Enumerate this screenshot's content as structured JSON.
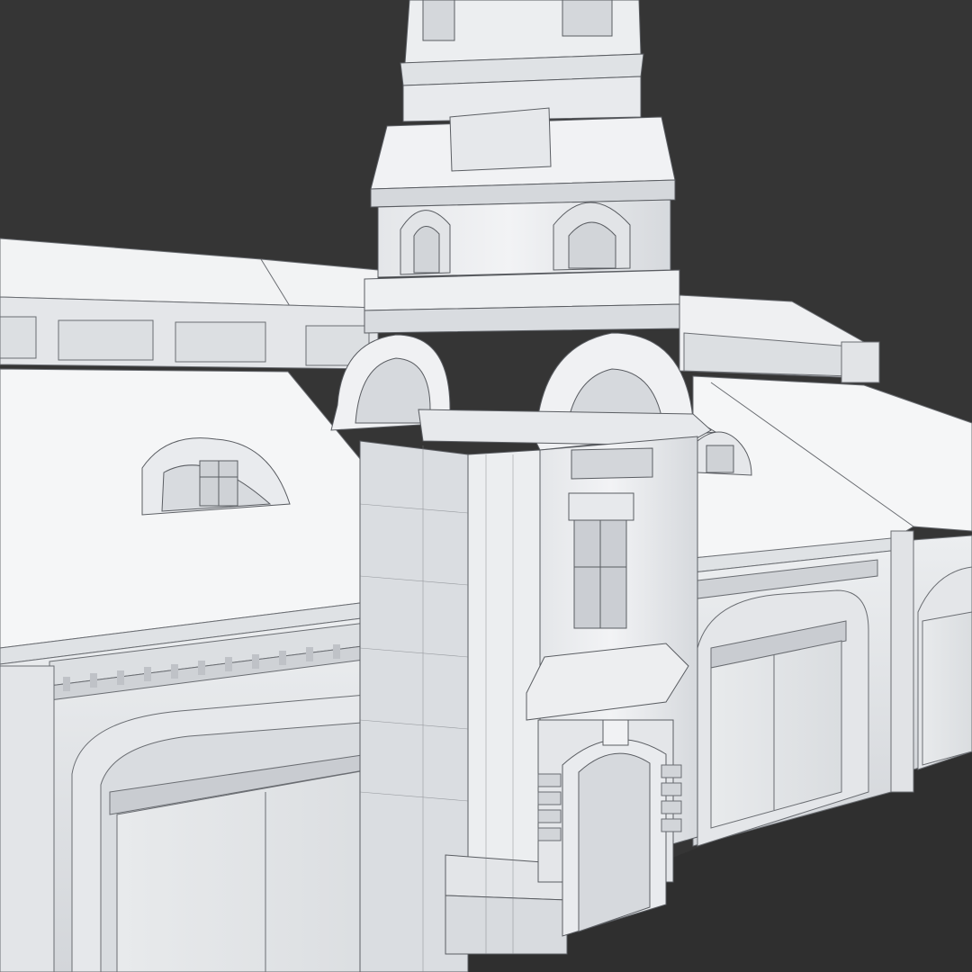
{
  "scene": {
    "subject": "building-render-clay-wireframe",
    "colors": {
      "background": "#353535",
      "ground": "#2f2f2f",
      "clay_light": "#f4f5f6",
      "clay_mid": "#dfe1e4",
      "clay_shadow": "#c4c7cb",
      "wire": "#5a5d62"
    }
  }
}
